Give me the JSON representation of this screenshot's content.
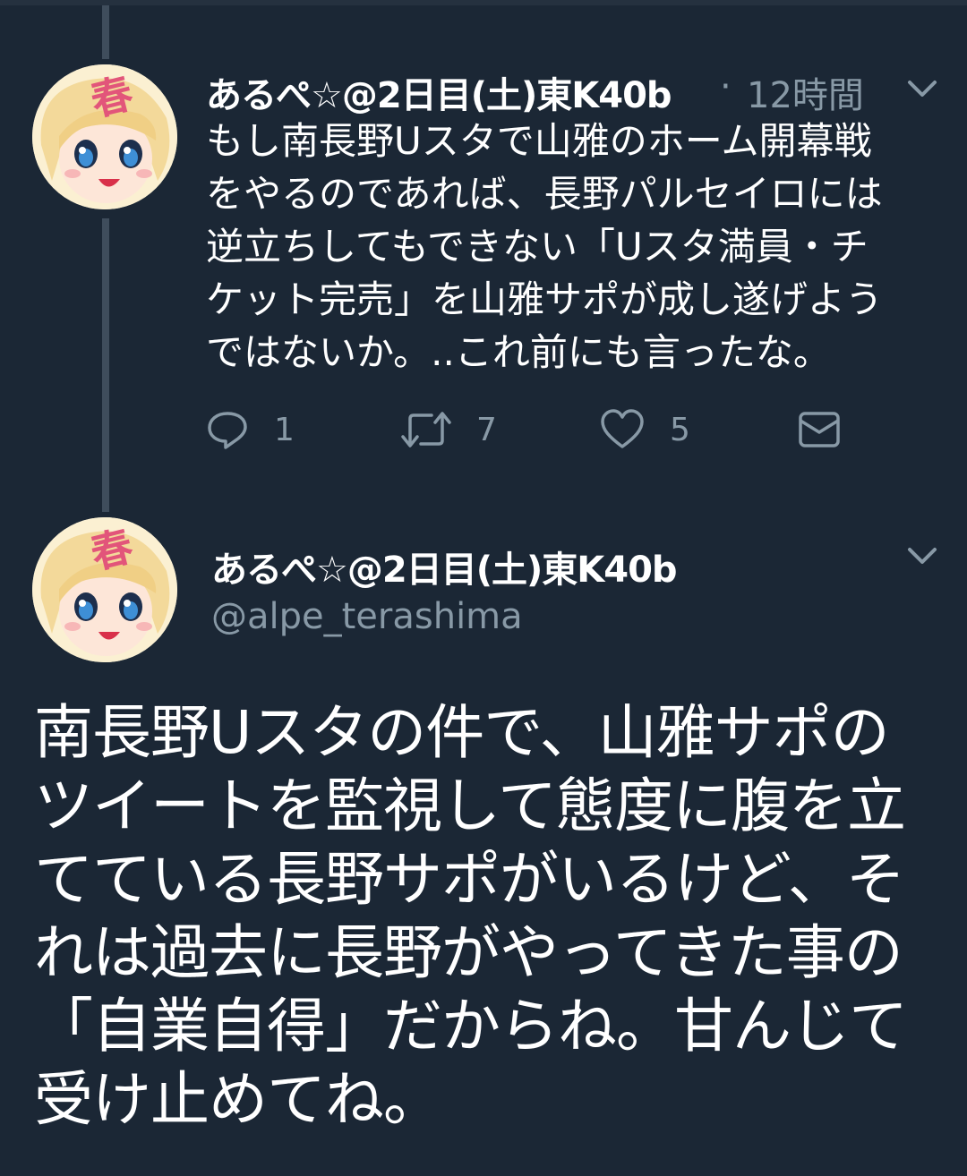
{
  "colors": {
    "background": "#1b2735",
    "text": "#ffffff",
    "muted": "#8899a6",
    "thread_line": "#3f4d5c"
  },
  "reply_tweet": {
    "author_name": "あるぺ☆@2日目(土)東K40b",
    "separator": "·",
    "time": "12時間",
    "text": "もし南長野Uスタで山雅のホーム開幕戦\nをやるのであれば、長野パルセイロには\n逆立ちしてもできない「Uスタ満員・チ\nケット完売」を山雅サポが成し遂げよう\nではないか。..これ前にも言ったな。",
    "actions": {
      "reply_icon": "reply-icon",
      "reply_count": "1",
      "retweet_icon": "retweet-icon",
      "retweet_count": "7",
      "like_icon": "heart-icon",
      "like_count": "5",
      "dm_icon": "envelope-icon"
    }
  },
  "main_tweet": {
    "author_name": "あるぺ☆@2日目(土)東K40b",
    "handle": "@alpe_terashima",
    "text": "南長野Uスタの件で、山雅サポの\nツイートを監視して態度に腹を立\nてている長野サポがいるけど、そ\nれは過去に長野がやってきた事の\n「自業自得」だからね。甘んじて\n受け止めてね。"
  },
  "avatar": {
    "badge_char": "春",
    "icon": "anime-girl-avatar"
  }
}
